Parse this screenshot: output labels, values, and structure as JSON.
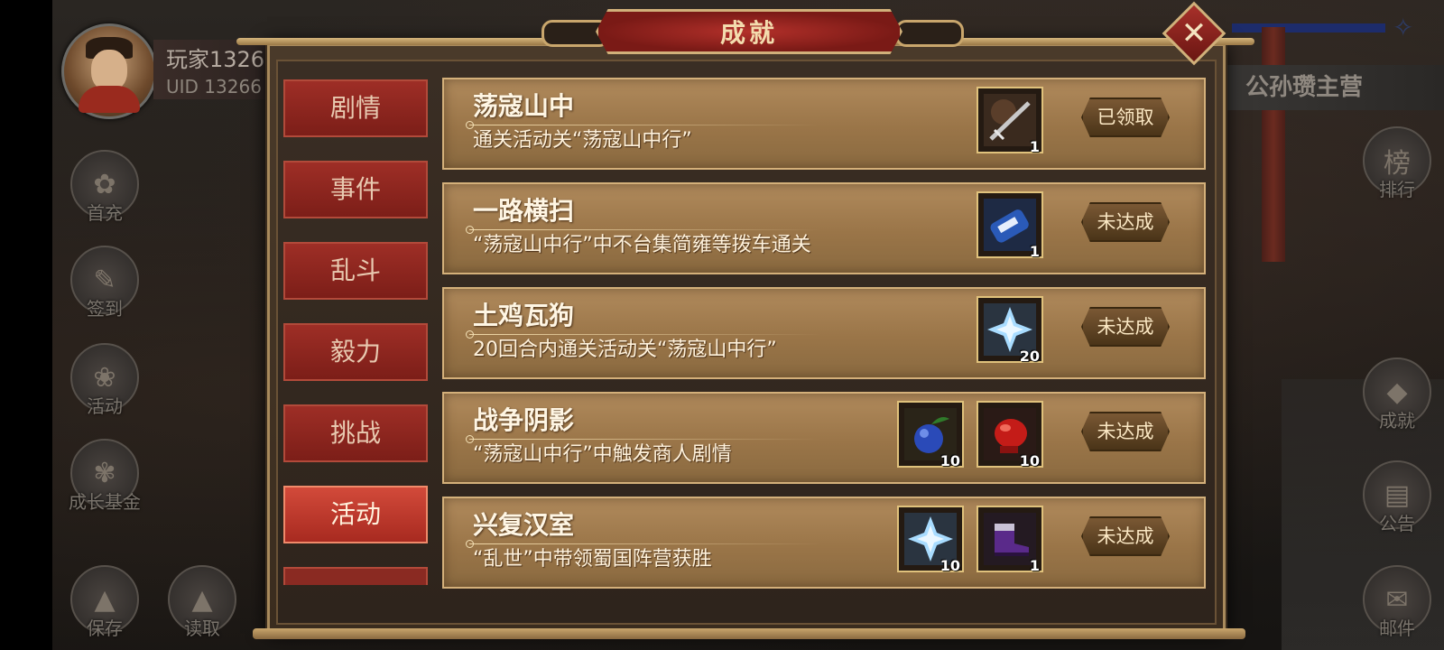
{
  "player": {
    "name": "玩家1326",
    "uid": "UID 13266"
  },
  "left_menu": [
    {
      "label": "首充",
      "glyph": "✿"
    },
    {
      "label": "签到",
      "glyph": "✎"
    },
    {
      "label": "活动",
      "glyph": "❀"
    },
    {
      "label": "成长基金",
      "glyph": "✾"
    },
    {
      "label": "保存",
      "glyph": "▲"
    },
    {
      "label": "读取",
      "glyph": "▲"
    }
  ],
  "right_menu": [
    {
      "label": "排行",
      "glyph": "榜"
    },
    {
      "label": "成就",
      "glyph": "◆"
    },
    {
      "label": "公告",
      "glyph": "▤"
    },
    {
      "label": "邮件",
      "glyph": "✉"
    }
  ],
  "camp_title": "公孙瓒主营",
  "modal": {
    "title": "成就",
    "close_glyph": "✕",
    "tabs": [
      "剧情",
      "事件",
      "乱斗",
      "毅力",
      "挑战",
      "活动"
    ],
    "active_tab": "活动",
    "achievements": [
      {
        "name": "荡寇山中",
        "desc": "通关活动关“荡寇山中行”",
        "status": "已领取",
        "rewards": [
          {
            "icon": "sword-item",
            "qty": "1"
          }
        ]
      },
      {
        "name": "一路横扫",
        "desc": "“荡寇山中行”中不台集简雍等拨车通关",
        "status": "未达成",
        "rewards": [
          {
            "icon": "scroll-item",
            "qty": "1"
          }
        ]
      },
      {
        "name": "土鸡瓦狗",
        "desc": "20回合内通关活动关“荡寇山中行”",
        "status": "未达成",
        "rewards": [
          {
            "icon": "ice-crystal-item",
            "qty": "20"
          }
        ]
      },
      {
        "name": "战争阴影",
        "desc": "“荡寇山中行”中触发商人剧情",
        "status": "未达成",
        "rewards": [
          {
            "icon": "blue-fruit-item",
            "qty": "10"
          },
          {
            "icon": "red-glove-item",
            "qty": "10"
          }
        ]
      },
      {
        "name": "兴复汉室",
        "desc": "“乱世”中带领蜀国阵营获胜",
        "status": "未达成",
        "rewards": [
          {
            "icon": "ice-crystal-item",
            "qty": "10"
          },
          {
            "icon": "purple-boot-item",
            "qty": "1"
          }
        ]
      }
    ]
  }
}
